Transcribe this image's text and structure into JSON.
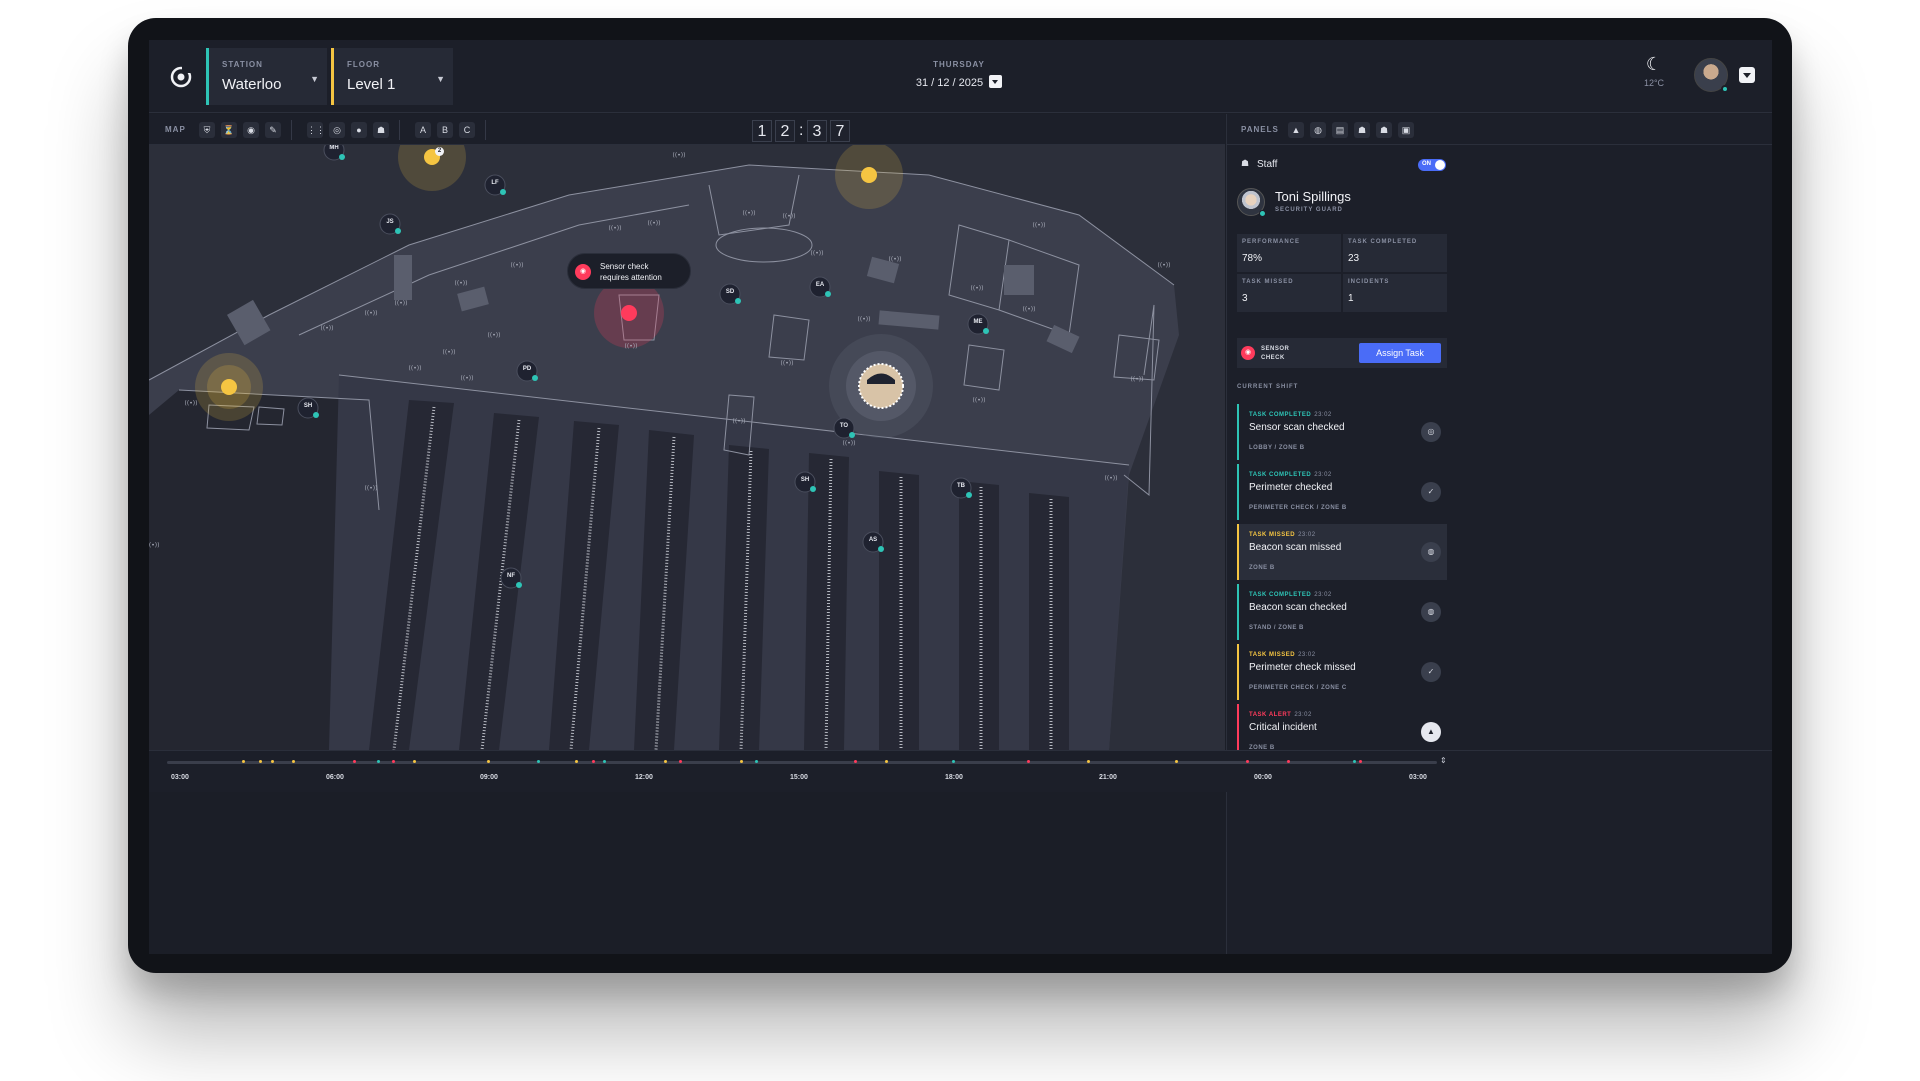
{
  "header": {
    "station_label": "STATION",
    "station_value": "Waterloo",
    "floor_label": "FLOOR",
    "floor_value": "Level 1",
    "day": "THURSDAY",
    "date": "31 / 12 / 2025",
    "temperature": "12°C"
  },
  "toolbar": {
    "map_label": "MAP",
    "zone_buttons": [
      "A",
      "B",
      "C"
    ],
    "counter_digits": [
      "1",
      "2",
      "3",
      "7"
    ],
    "counter_separator": ":"
  },
  "right_panel": {
    "panels_label": "PANELS",
    "staff_label": "Staff",
    "staff_toggle": "ON",
    "profile": {
      "name": "Toni Spillings",
      "role": "SECURITY GUARD"
    },
    "stats": [
      {
        "label": "PERFORMANCE",
        "value": "78%"
      },
      {
        "label": "TASK COMPLETED",
        "value": "23"
      },
      {
        "label": "TASK MISSED",
        "value": "3"
      },
      {
        "label": "INCIDENTS",
        "value": "1"
      }
    ],
    "sensor_card": {
      "text": "SENSOR CHECK",
      "action": "Assign Task"
    },
    "current_shift_label": "CURRENT SHIFT",
    "tasks": [
      {
        "status": "TASK COMPLETED",
        "time": "23:02",
        "title": "Sensor scan checked",
        "sub": "LOBBY / ZONE B",
        "status_color": "#2ec4b6",
        "icon": "sensor-icon"
      },
      {
        "status": "TASK COMPLETED",
        "time": "23:02",
        "title": "Perimeter checked",
        "sub": "PERIMETER CHECK / ZONE B",
        "status_color": "#2ec4b6",
        "icon": "check-circle-icon"
      },
      {
        "status": "TASK MISSED",
        "time": "23:02",
        "title": "Beacon scan missed",
        "sub": "ZONE B",
        "status_color": "#f5c542",
        "icon": "beacon-icon"
      },
      {
        "status": "TASK COMPLETED",
        "time": "23:02",
        "title": "Beacon scan checked",
        "sub": "STAND / ZONE B",
        "status_color": "#2ec4b6",
        "icon": "beacon-icon"
      },
      {
        "status": "TASK MISSED",
        "time": "23:02",
        "title": "Perimeter check missed",
        "sub": "PERIMETER CHECK / ZONE C",
        "status_color": "#f5c542",
        "icon": "check-circle-icon"
      },
      {
        "status": "TASK ALERT",
        "time": "23:02",
        "title": "Critical incident",
        "sub": "ZONE B",
        "status_color": "#ff3b5c",
        "icon": "warning-icon"
      }
    ]
  },
  "map": {
    "alert_text_line1": "Sensor check",
    "alert_text_line2": "requires attention",
    "staff_markers": [
      "MH",
      "LF",
      "JS",
      "SD",
      "EA",
      "ME",
      "PD",
      "SH",
      "TO",
      "SH",
      "TB",
      "AS",
      "NF"
    ],
    "cluster_badge": "2"
  },
  "timeline": {
    "times": [
      "03:00",
      "06:00",
      "09:00",
      "12:00",
      "15:00",
      "18:00",
      "21:00",
      "00:00",
      "03:00"
    ]
  },
  "colors": {
    "accent": "#4a6cf7",
    "teal": "#2ec4b6",
    "alert": "#ff3b5c",
    "warning": "#f5c542"
  }
}
